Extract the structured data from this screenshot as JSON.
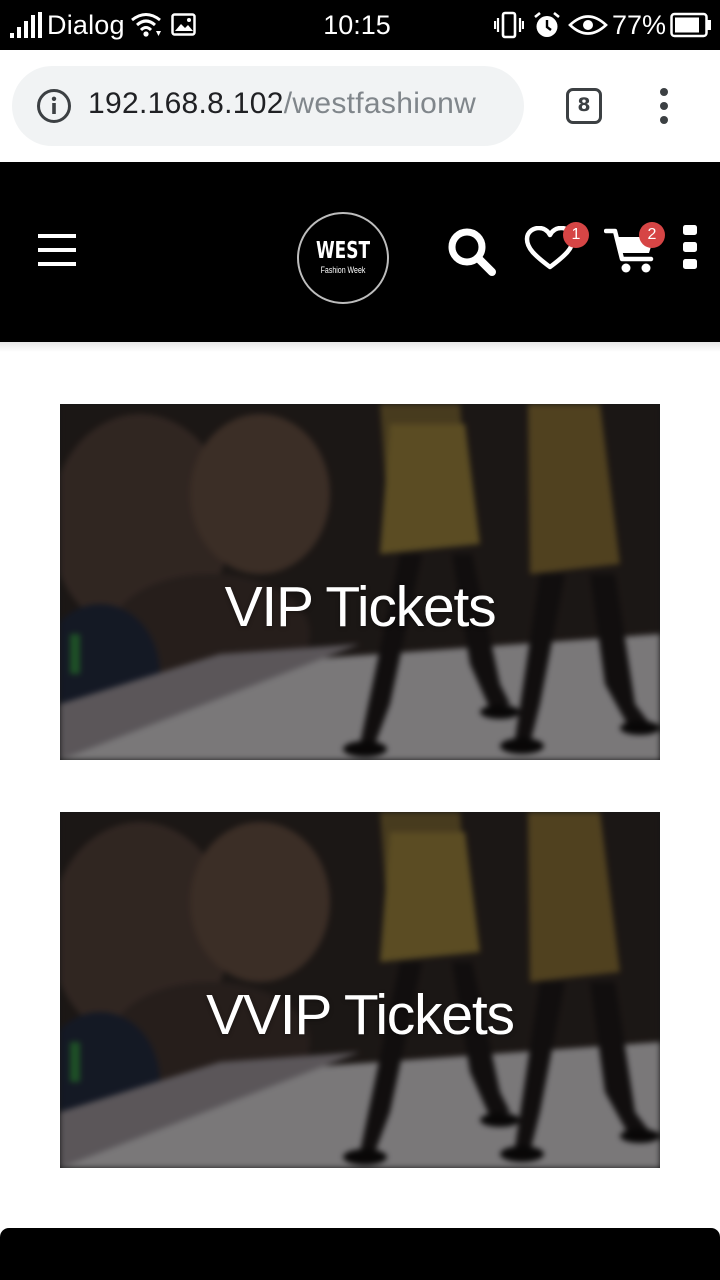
{
  "status_bar": {
    "carrier": "Dialog",
    "time": "10:15",
    "battery": "77%",
    "icons": [
      "signal-icon",
      "wifi-icon",
      "gallery-notification-icon",
      "vibrate-icon",
      "alarm-icon",
      "eye-comfort-icon",
      "battery-icon"
    ]
  },
  "browser": {
    "url_host": "192.168.8.102",
    "url_path": "/westfashionw",
    "tab_count": "8",
    "icons": [
      "info-icon",
      "more-vert-icon"
    ]
  },
  "header": {
    "logo_main": "WEST",
    "logo_sub": "Fashion Week",
    "wishlist_count": "1",
    "cart_count": "2",
    "icons": [
      "hamburger-menu-icon",
      "search-icon",
      "heart-icon",
      "cart-icon",
      "more-vert-icon"
    ]
  },
  "tickets": [
    {
      "label": "VIP Tickets"
    },
    {
      "label": "VVIP Tickets"
    }
  ],
  "colors": {
    "header_bg": "#000000",
    "badge": "#d64545",
    "page_bg": "#ffffff",
    "url_pill": "#f1f3f4"
  }
}
